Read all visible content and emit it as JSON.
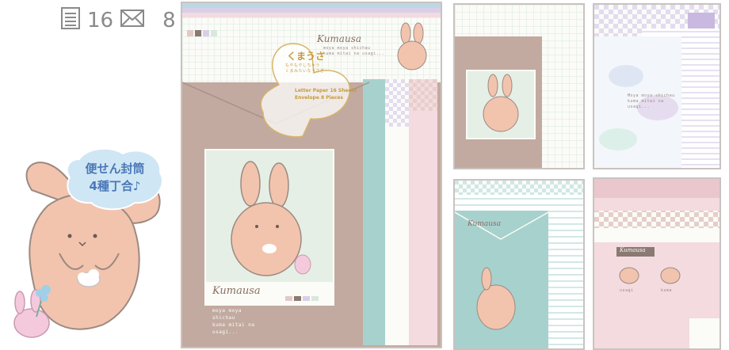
{
  "counts": {
    "letter_count": "16",
    "envelope_count": "8",
    "letter_icon": "letter-sheet-icon",
    "envelope_icon": "envelope-icon"
  },
  "bubble": {
    "line1": "便せん封筒",
    "line2": "4種丁合♪"
  },
  "product": {
    "brand": "Kumausa",
    "sticker_title": "くまうさ",
    "sticker_sub1": "もやもやしちゃう",
    "sticker_sub2": "くまみたいなうさぎ",
    "sticker_line1": "Letter Paper 16 Sheets",
    "sticker_line2": "Envelope 8 Pieces",
    "tagline_top1": "moya moya shichau",
    "tagline_top2": "kuma mitai na usagi...",
    "tagline_bottom1": "moya moya",
    "tagline_bottom2": "shichau",
    "tagline_bottom3": "kuma mitai na",
    "tagline_bottom4": "usagi..."
  },
  "variants": {
    "v2_tagline": "Moya moya shichau kuma mitai na usagi...",
    "v3_label": "Kumausa",
    "v3_cap1": "usagi",
    "v3_cap2": "kuma"
  },
  "colors": {
    "mocha": "#c2aaa0",
    "bunny": "#f2c4ae",
    "bubble_blue": "#4a78b8",
    "mint": "#e6efe5",
    "frame": "#c9c3c0"
  }
}
